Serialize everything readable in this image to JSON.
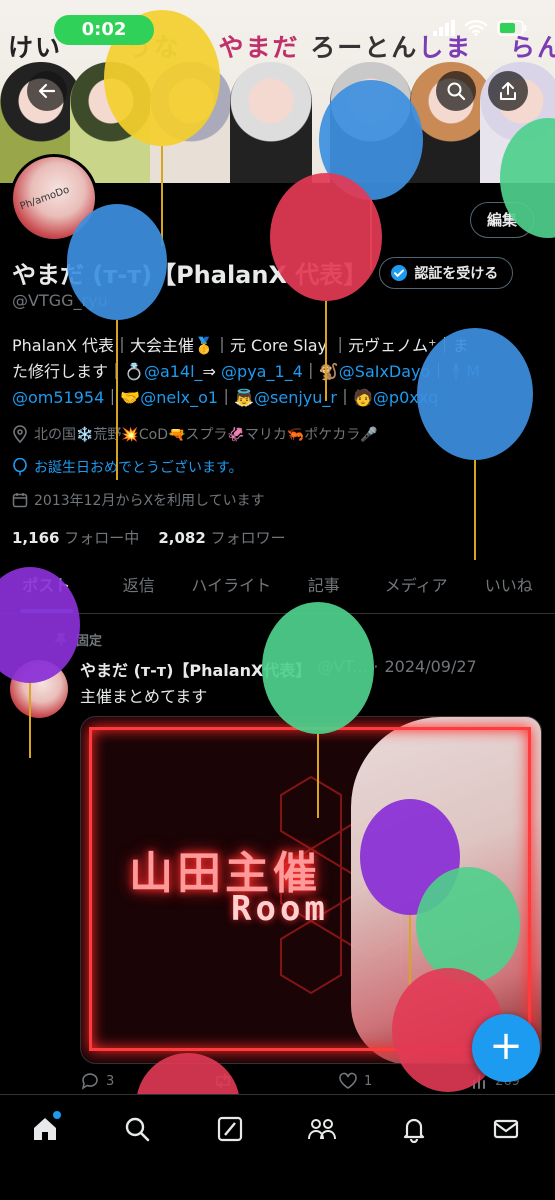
{
  "status_bar": {
    "time": "0:02"
  },
  "banner": {
    "title_parts": [
      "けい",
      "うな",
      "やまだ",
      "ろーとん",
      "しま",
      "らん"
    ]
  },
  "header": {
    "back_icon": "arrow-left-icon",
    "search_icon": "search-icon",
    "share_icon": "share-icon"
  },
  "profile": {
    "avatar_text": "Ph/amoDo",
    "edit_label": "編集",
    "display_name": "やまだ (т-т)【PhalanX 代表】",
    "verify_label": "認証を受ける",
    "handle": "@VTGG_ryu",
    "bio_lines": [
      [
        "PhalanX 代表｜大会主催🥇｜元 Core Slay ｜元ヴェノム⁺｜ま",
        ""
      ],
      [
        "た修行します｜💍",
        "@a14l_",
        "⇒ ",
        "@pya_1_4",
        "｜🐒",
        "@SaIxDayo",
        "｜🕴",
        "M"
      ],
      [
        "",
        "@om51954",
        "｜🤝",
        "@nelx_o1",
        "｜👼",
        "@senjyu_r",
        "｜🧑",
        "@p0xxq"
      ]
    ],
    "location": "北の国❄️荒野💥CoD🔫スプラ🦑マリカ🦐ポケカラ🎤",
    "birthday": "お誕生日おめでとうございます。",
    "joined": "2013年12月からXを利用しています",
    "following_count": "1,166",
    "following_label": "フォロー中",
    "followers_count": "2,082",
    "followers_label": "フォロワー"
  },
  "tabs": [
    "ポスト",
    "返信",
    "ハイライト",
    "記事",
    "メディア",
    "いいね"
  ],
  "post": {
    "pinned_label": "固定",
    "author_name": "やまだ (т-т)【PhalanX代表】",
    "author_handle": "@VT...",
    "date": "2024/09/27",
    "text": "主催まとめてます",
    "media_title": "山田主催",
    "media_subtitle": "Room",
    "replies": "3",
    "reposts": "",
    "likes": "1",
    "views": "269"
  },
  "fab_label": "+",
  "colors": {
    "accent": "#1d9bf0",
    "background": "#000000",
    "secondary_text": "#71767b",
    "balloon_yellow": "#f4cf2e",
    "balloon_blue": "#3d8fe0",
    "balloon_red": "#e23a55",
    "balloon_green": "#4fd08c",
    "balloon_purple": "#8a2fd6"
  },
  "bottom_nav": [
    "home-icon",
    "search-icon",
    "grok-icon",
    "communities-icon",
    "notifications-icon",
    "messages-icon"
  ]
}
